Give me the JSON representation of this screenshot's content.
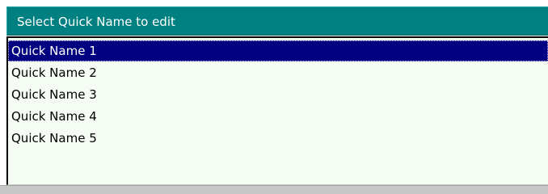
{
  "dialog": {
    "title": "Select Quick Name to edit"
  },
  "list": {
    "selected_index": 0,
    "items": [
      {
        "label": "Quick Name 1"
      },
      {
        "label": "Quick Name 2"
      },
      {
        "label": "Quick Name 3"
      },
      {
        "label": "Quick Name 4"
      },
      {
        "label": "Quick Name 5"
      }
    ]
  },
  "colors": {
    "title_background": "#008080",
    "selection_background": "#000080",
    "list_background": "#f4fcf3"
  }
}
